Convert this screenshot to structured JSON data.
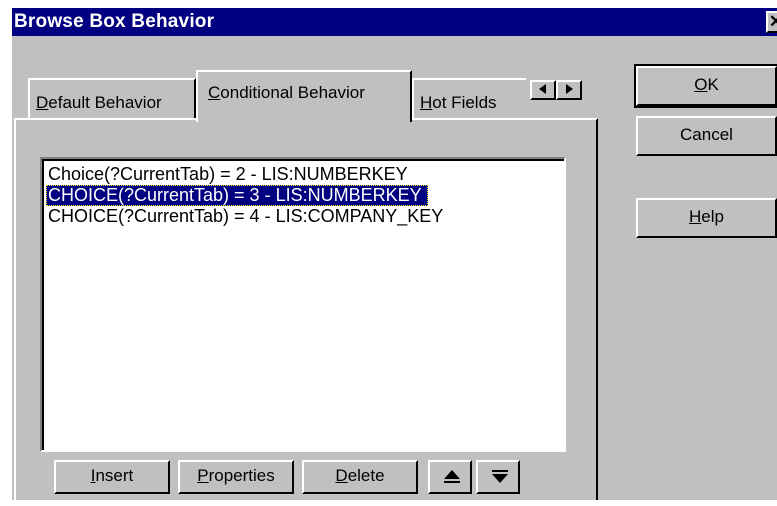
{
  "window": {
    "title": "Browse Box Behavior",
    "close_glyph": "✕"
  },
  "tabs": [
    {
      "label": "Default Behavior",
      "accel": "D"
    },
    {
      "label": "Conditional Behavior",
      "accel": "C",
      "active": true
    },
    {
      "label": "Hot Fields",
      "accel": "H"
    }
  ],
  "tab_scroll": {
    "left_icon": "triangle-left-icon",
    "right_icon": "triangle-right-icon"
  },
  "list": {
    "items": [
      "Choice(?CurrentTab) = 2 - LIS:NUMBERKEY",
      "CHOICE(?CurrentTab) = 3 - LIS:NUMBERKEY",
      "CHOICE(?CurrentTab) = 4 - LIS:COMPANY_KEY"
    ],
    "selected_index": 1
  },
  "list_buttons": {
    "insert": "Insert",
    "properties": "Properties",
    "delete": "Delete",
    "move_up_icon": "arrow-up-icon",
    "move_down_icon": "arrow-down-icon"
  },
  "dialog_buttons": {
    "ok": "OK",
    "cancel": "Cancel",
    "help": "Help"
  },
  "colors": {
    "face": "#c0c0c0",
    "title_bar": "#000080",
    "selection": "#000080"
  }
}
